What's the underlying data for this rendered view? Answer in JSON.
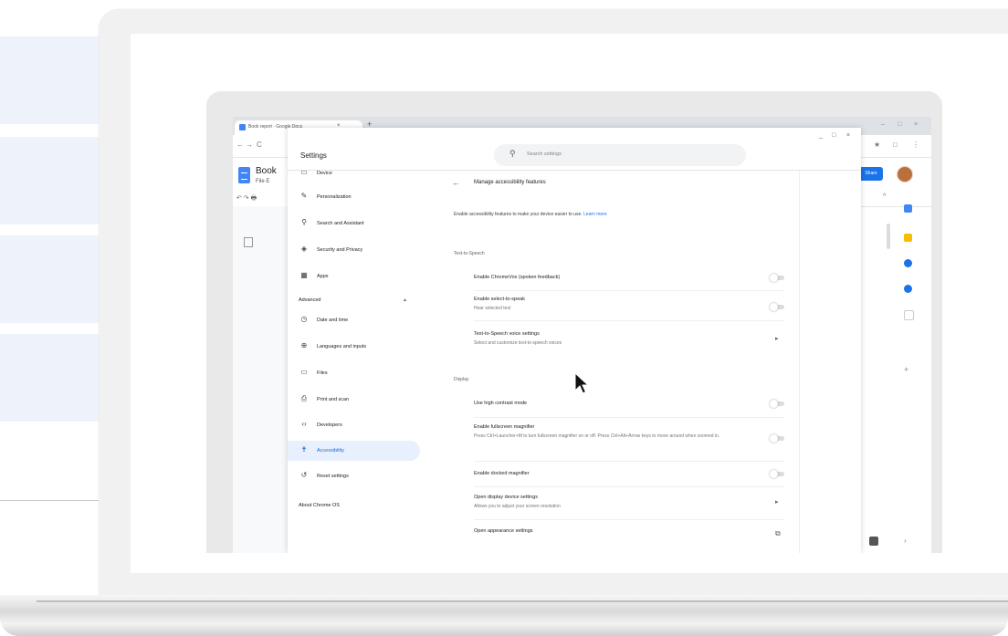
{
  "browser": {
    "tab_title": "Book report - Google Docs",
    "tab_close": "×",
    "new_tab": "+",
    "win_min": "–",
    "win_max": "□",
    "win_close": "×",
    "nav_back": "←",
    "nav_forward": "→",
    "nav_reload": "C",
    "ext_star": "★",
    "ext_puzzle": "□",
    "menu_dots": "⋮"
  },
  "doc": {
    "title": "Book",
    "menu": "File E",
    "toolbar": "↶ ↷ 🖶",
    "share_label": "Share",
    "side_expand": "^",
    "side_more": "›"
  },
  "settings": {
    "title": "Settings",
    "search_placeholder": "Search settings",
    "win_min": "_",
    "win_max": "□",
    "win_close": "×",
    "nav": [
      {
        "label": "Device",
        "icon": "▭"
      },
      {
        "label": "Personalization",
        "icon": "✎"
      },
      {
        "label": "Search and Assistant",
        "icon": "⚲"
      },
      {
        "label": "Security and Privacy",
        "icon": "◈"
      },
      {
        "label": "Apps",
        "icon": "▦"
      },
      {
        "label": "Date and time",
        "icon": "◷"
      },
      {
        "label": "Languages and inputs",
        "icon": "⊕"
      },
      {
        "label": "Files",
        "icon": "▭"
      },
      {
        "label": "Print and scan",
        "icon": "⎙"
      },
      {
        "label": "Developers",
        "icon": "‹›"
      },
      {
        "label": "Accessibility",
        "icon": "✝"
      },
      {
        "label": "Reset settings",
        "icon": "↺"
      }
    ],
    "advanced_label": "Advanced",
    "about_label": "About Chrome OS",
    "page_title": "Manage accessibility features",
    "intro": "Enable accessibility features to make your device easier to use.",
    "learn_more": "Learn more",
    "sections": {
      "tts": "Text-to-Speech",
      "display": "Display"
    },
    "rows": {
      "chromevox": {
        "label": "Enable ChromeVox (spoken feedback)",
        "enabled": false
      },
      "select_to_speak": {
        "label": "Enable select-to-speak",
        "sub": "Hear selected text",
        "enabled": false
      },
      "tts_voice": {
        "label": "Text-to-Speech voice settings",
        "sub": "Select and customize text-to-speech voices"
      },
      "high_contrast": {
        "label": "Use high contrast mode",
        "enabled": false
      },
      "fullscreen_mag": {
        "label": "Enable fullscreen magnifier",
        "sub": "Press Ctrl+Launcher+M to turn fullscreen magnifier on or off. Press Ctrl+Alt+Arrow keys to move around when zoomed in.",
        "enabled": false
      },
      "docked_mag": {
        "label": "Enable docked magnifier",
        "enabled": false
      },
      "display_device": {
        "label": "Open display device settings",
        "sub": "Allows you to adjust your screen resolution"
      },
      "appearance": {
        "label": "Open appearance settings"
      }
    }
  },
  "colors": {
    "accent": "#1a73e8",
    "active_nav_bg": "#e8f0fe",
    "side_panel": "#edf2fb"
  }
}
